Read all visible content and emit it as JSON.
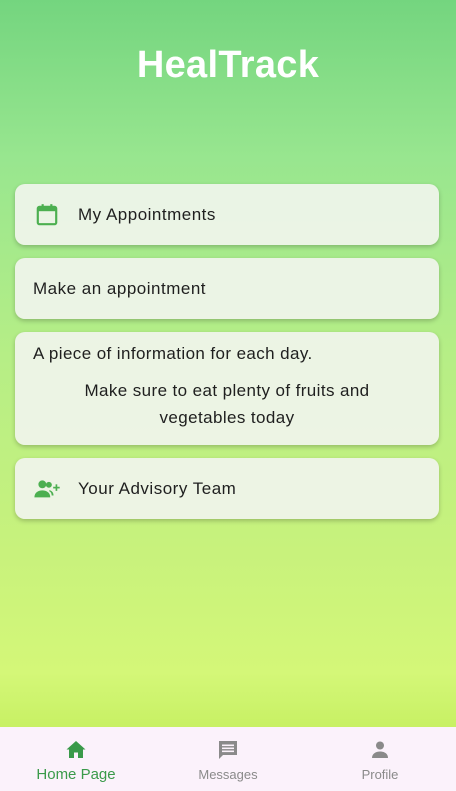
{
  "app": {
    "title": "HealTrack"
  },
  "cards": {
    "appointments": {
      "label": "My Appointments",
      "icon": "calendar-icon"
    },
    "make_appointment": {
      "label": "Make an appointment"
    },
    "daily_info": {
      "title": "A piece of information for each day.",
      "body": "Make sure to eat plenty of fruits and vegetables today"
    },
    "advisory_team": {
      "label": "Your Advisory Team",
      "icon": "group-add-icon"
    }
  },
  "bottom_nav": {
    "items": [
      {
        "label": "Home Page",
        "icon": "home-icon",
        "active": true
      },
      {
        "label": "Messages",
        "icon": "messages-icon",
        "active": false
      },
      {
        "label": "Profile",
        "icon": "profile-icon",
        "active": false
      }
    ]
  },
  "colors": {
    "accent": "#3a9a4a",
    "icon_green": "#4caf50",
    "inactive": "#8a8a8a",
    "nav_background": "#fbf2fb"
  }
}
